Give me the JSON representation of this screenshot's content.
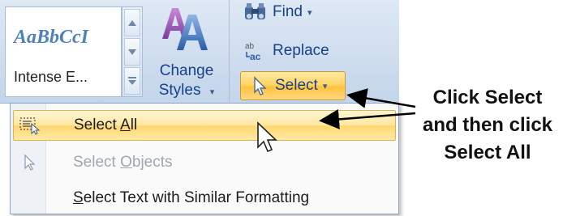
{
  "ribbon": {
    "styles_gallery": {
      "sample_text": "AaBbCcI",
      "style_name": "Intense E..."
    },
    "change_styles": {
      "label_line1": "Change",
      "label_line2": "Styles",
      "dropdown_arrow": "▾"
    },
    "editing": {
      "find_label": "Find",
      "replace_label": "Replace",
      "select_label": "Select",
      "dropdown_arrow": "▾"
    }
  },
  "select_menu": {
    "items": [
      {
        "label_prefix": "Select ",
        "label_access": "A",
        "label_suffix": "ll",
        "state": "highlighted",
        "icon": "select-all-icon"
      },
      {
        "label_prefix": "Select ",
        "label_access": "O",
        "label_suffix": "bjects",
        "state": "disabled",
        "icon": "arrow-pointer-icon"
      },
      {
        "label_prefix": "",
        "label_access": "S",
        "label_suffix": "elect Text with Similar Formatting",
        "state": "normal",
        "icon": ""
      }
    ]
  },
  "annotation": {
    "line1": "Click Select",
    "line2": "and then click",
    "line3": "Select All"
  },
  "colors": {
    "ribbon_text": "#15428b",
    "highlight": "#ffd76e",
    "disabled_text": "#9ea7b3"
  }
}
